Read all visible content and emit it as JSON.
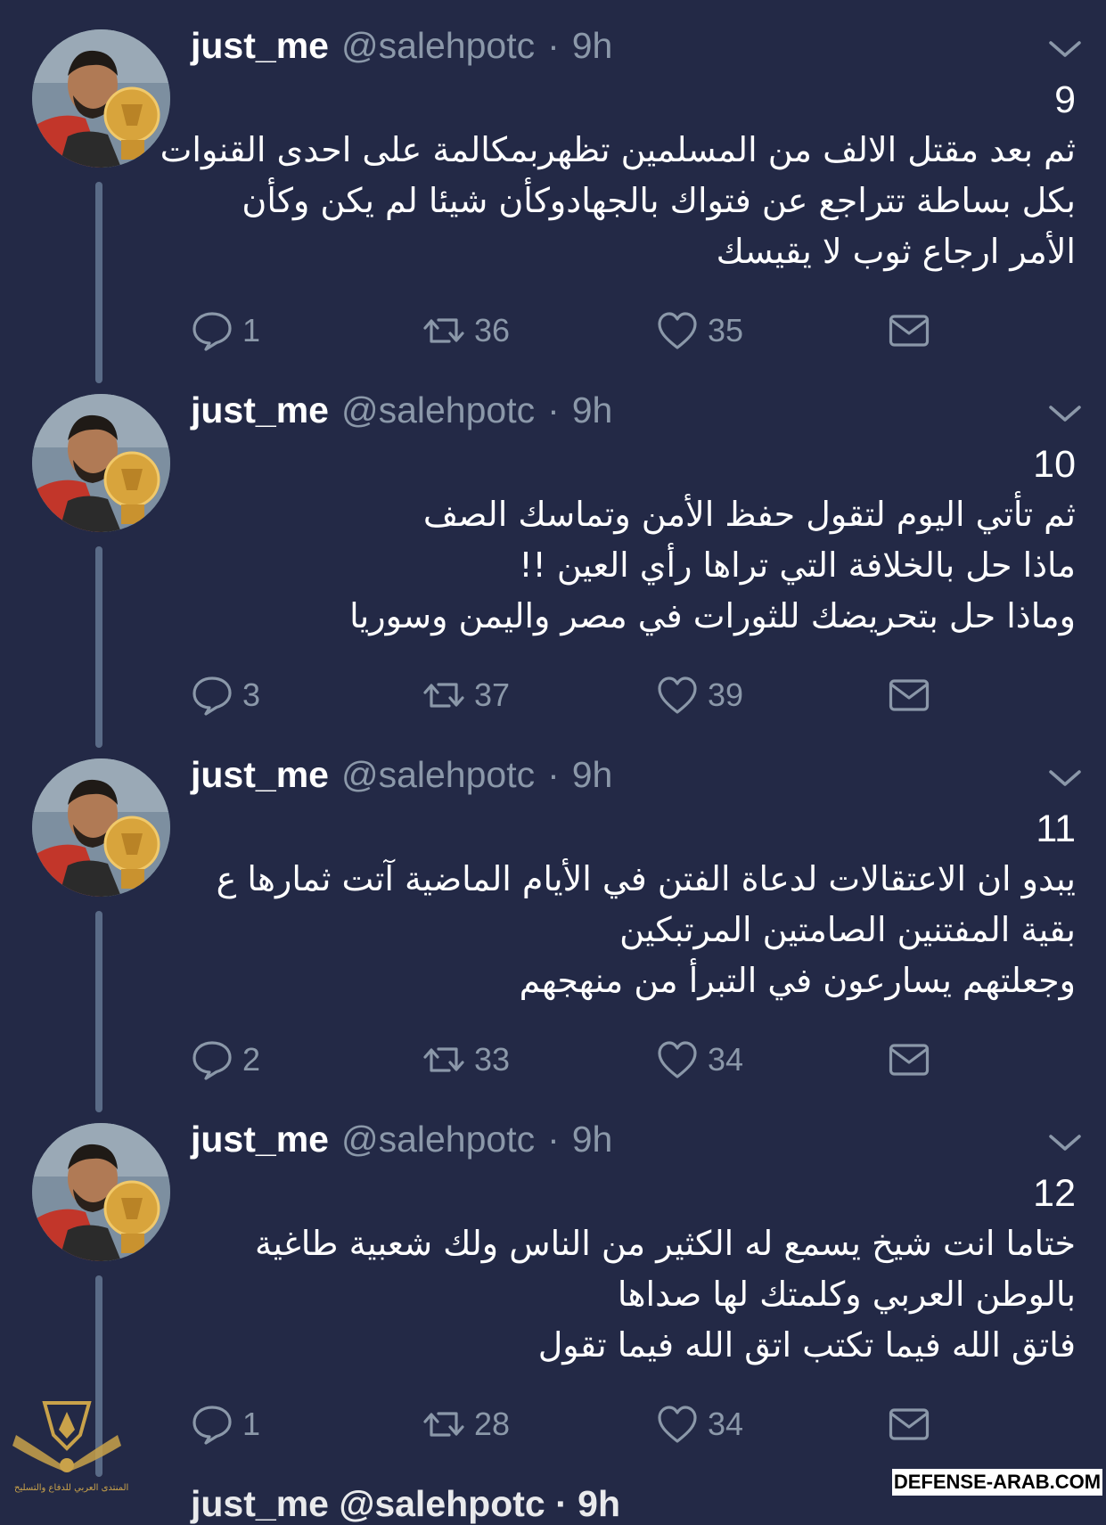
{
  "tweets": [
    {
      "name": "just_me",
      "handle": "@salehpotc",
      "separator": "·",
      "time": "9h",
      "number": "9",
      "lines": [
        "ثم بعد مقتل الالف من المسلمين تظهربمكالمة على احدى القنوات",
        "بكل بساطة تتراجع عن فتواك بالجهادوكأن شيئا لم يكن وكأن",
        "الأمر ارجاع ثوب لا يقيسك"
      ],
      "replies": "1",
      "retweets": "36",
      "likes": "35"
    },
    {
      "name": "just_me",
      "handle": "@salehpotc",
      "separator": "·",
      "time": "9h",
      "number": "10",
      "lines": [
        "ثم تأتي اليوم لتقول حفظ الأمن وتماسك الصف",
        "ماذا حل بالخلافة التي تراها رأي العين !!",
        "وماذا حل بتحريضك للثورات في مصر واليمن وسوريا"
      ],
      "replies": "3",
      "retweets": "37",
      "likes": "39"
    },
    {
      "name": "just_me",
      "handle": "@salehpotc",
      "separator": "·",
      "time": "9h",
      "number": "11",
      "lines": [
        "يبدو ان الاعتقالات لدعاة الفتن في الأيام الماضية آتت ثمارها ع",
        "بقية المفتنين الصامتين المرتبكين",
        "وجعلتهم يسارعون في التبرأ من منهجهم"
      ],
      "replies": "2",
      "retweets": "33",
      "likes": "34"
    },
    {
      "name": "just_me",
      "handle": "@salehpotc",
      "separator": "·",
      "time": "9h",
      "number": "12",
      "lines": [
        "ختاما انت شيخ يسمع له الكثير من الناس ولك شعبية طاغية",
        "بالوطن العربي وكلمتك لها صداها",
        "فاتق الله فيما تكتب اتق الله فيما تقول"
      ],
      "replies": "1",
      "retweets": "28",
      "likes": "34"
    }
  ],
  "next_tweet_partial": "just_me @salehpotc · 9h",
  "watermark": "DEFENSE-ARAB.COM",
  "logo_text": "المنتدى العربي للدفاع والتسليح",
  "icons": {
    "reply": "reply-bubble-icon",
    "retweet": "retweet-icon",
    "like": "heart-icon",
    "dm": "envelope-icon",
    "menu": "chevron-down-icon"
  },
  "colors": {
    "background": "#232946",
    "text": "#ffffff",
    "muted": "#8b98a9",
    "thread_line": "#5a6b87"
  }
}
